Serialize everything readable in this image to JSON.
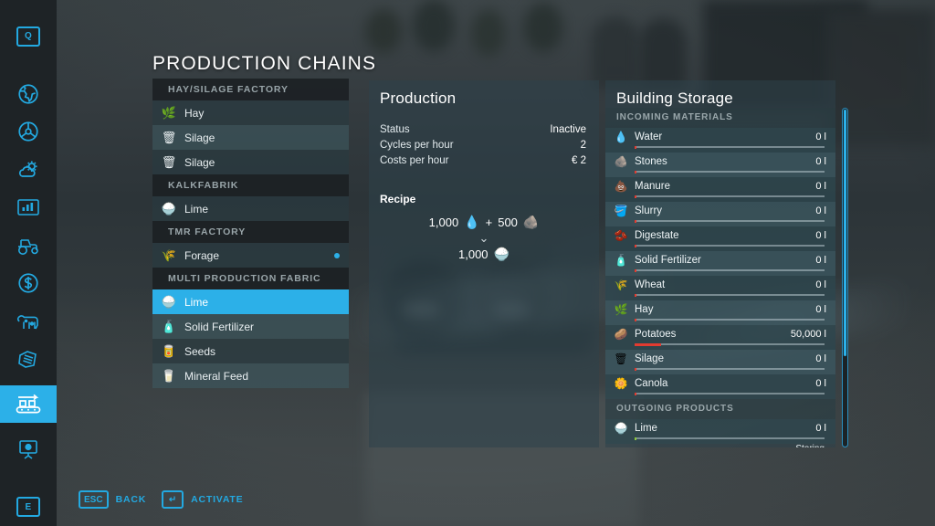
{
  "page": {
    "title": "PRODUCTION CHAINS"
  },
  "colors": {
    "accent": "#2cb0e8",
    "accent_dark": "#23a9e1",
    "panel_bg": "#2e424a",
    "bar_red": "#e23b30",
    "bar_green": "#8bc63e",
    "text": "#eef4f6"
  },
  "sidebar": {
    "items": [
      {
        "name": "quick-menu-key",
        "icon": "key-q",
        "label": "Q",
        "active": false
      },
      {
        "name": "map",
        "icon": "globe-icon",
        "label": "",
        "active": false
      },
      {
        "name": "vehicles",
        "icon": "steering-wheel-icon",
        "label": "",
        "active": false
      },
      {
        "name": "weather",
        "icon": "weather-icon",
        "label": "",
        "active": false
      },
      {
        "name": "statistics",
        "icon": "chart-icon",
        "label": "",
        "active": false
      },
      {
        "name": "vehicle-list",
        "icon": "tractor-icon",
        "label": "",
        "active": false
      },
      {
        "name": "finances",
        "icon": "money-icon",
        "label": "",
        "active": false
      },
      {
        "name": "animals",
        "icon": "cow-icon",
        "label": "",
        "active": false
      },
      {
        "name": "contracts",
        "icon": "documents-icon",
        "label": "",
        "active": false
      },
      {
        "name": "production",
        "icon": "conveyor-icon",
        "label": "",
        "active": true
      },
      {
        "name": "multiplayer",
        "icon": "presentation-icon",
        "label": "",
        "active": false
      },
      {
        "name": "interact-key",
        "icon": "key-e",
        "label": "E",
        "active": false
      }
    ]
  },
  "chain_list": {
    "groups": [
      {
        "header": "HAY/SILAGE FACTORY",
        "items": [
          {
            "label": "Hay",
            "icon": "hay-icon",
            "selected": false,
            "active": false
          },
          {
            "label": "Silage",
            "icon": "silage-icon",
            "selected": false,
            "active": false
          },
          {
            "label": "Silage",
            "icon": "silage-icon",
            "selected": false,
            "active": false
          }
        ]
      },
      {
        "header": "KALKFABRIK",
        "items": [
          {
            "label": "Lime",
            "icon": "lime-icon",
            "selected": false,
            "active": false
          }
        ]
      },
      {
        "header": "TMR FACTORY",
        "items": [
          {
            "label": "Forage",
            "icon": "forage-icon",
            "selected": false,
            "active": true
          }
        ]
      },
      {
        "header": "MULTI PRODUCTION FABRIC",
        "items": [
          {
            "label": "Lime",
            "icon": "lime-icon",
            "selected": true,
            "active": false
          },
          {
            "label": "Solid Fertilizer",
            "icon": "fertilizer-icon",
            "selected": false,
            "active": false
          },
          {
            "label": "Seeds",
            "icon": "seeds-icon",
            "selected": false,
            "active": false
          },
          {
            "label": "Mineral Feed",
            "icon": "mineral-feed-icon",
            "selected": false,
            "active": false
          }
        ]
      }
    ]
  },
  "production": {
    "title": "Production",
    "stats": [
      {
        "label": "Status",
        "value": "Inactive"
      },
      {
        "label": "Cycles per hour",
        "value": "2"
      },
      {
        "label": "Costs per hour",
        "value": "€ 2"
      }
    ],
    "recipe_title": "Recipe",
    "recipe": {
      "inputs": [
        {
          "amount": "1,000",
          "icon": "water-icon"
        },
        {
          "amount": "500",
          "icon": "stones-icon"
        }
      ],
      "plus": "+",
      "arrow": "⌄",
      "outputs": [
        {
          "amount": "1,000",
          "icon": "lime-icon"
        }
      ]
    }
  },
  "storage": {
    "title": "Building Storage",
    "sections": [
      {
        "header": "INCOMING MATERIALS",
        "rows": [
          {
            "label": "Water",
            "amount": "0 l",
            "icon": "water-icon",
            "fill_pct": 0,
            "bar_color": "red"
          },
          {
            "label": "Stones",
            "amount": "0 l",
            "icon": "stones-icon",
            "fill_pct": 0,
            "bar_color": "red"
          },
          {
            "label": "Manure",
            "amount": "0 l",
            "icon": "manure-icon",
            "fill_pct": 0,
            "bar_color": "red"
          },
          {
            "label": "Slurry",
            "amount": "0 l",
            "icon": "slurry-icon",
            "fill_pct": 0,
            "bar_color": "red"
          },
          {
            "label": "Digestate",
            "amount": "0 l",
            "icon": "digestate-icon",
            "fill_pct": 0,
            "bar_color": "red"
          },
          {
            "label": "Solid Fertilizer",
            "amount": "0 l",
            "icon": "fertilizer-icon",
            "fill_pct": 0,
            "bar_color": "red"
          },
          {
            "label": "Wheat",
            "amount": "0 l",
            "icon": "wheat-icon",
            "fill_pct": 0,
            "bar_color": "red"
          },
          {
            "label": "Hay",
            "amount": "0 l",
            "icon": "hay-icon",
            "fill_pct": 0,
            "bar_color": "red"
          },
          {
            "label": "Potatoes",
            "amount": "50,000 l",
            "icon": "potatoes-icon",
            "fill_pct": 14,
            "bar_color": "red"
          },
          {
            "label": "Silage",
            "amount": "0 l",
            "icon": "silage-icon",
            "fill_pct": 0,
            "bar_color": "red"
          },
          {
            "label": "Canola",
            "amount": "0 l",
            "icon": "canola-icon",
            "fill_pct": 0,
            "bar_color": "red"
          }
        ]
      },
      {
        "header": "OUTGOING PRODUCTS",
        "rows": [
          {
            "label": "Lime",
            "amount": "0 l",
            "icon": "lime-icon",
            "fill_pct": 0,
            "bar_color": "green",
            "sublabel": "Storing"
          }
        ]
      }
    ]
  },
  "helpbar": {
    "items": [
      {
        "key": "ESC",
        "label": "BACK"
      },
      {
        "key": "↵",
        "label": "ACTIVATE"
      }
    ]
  }
}
